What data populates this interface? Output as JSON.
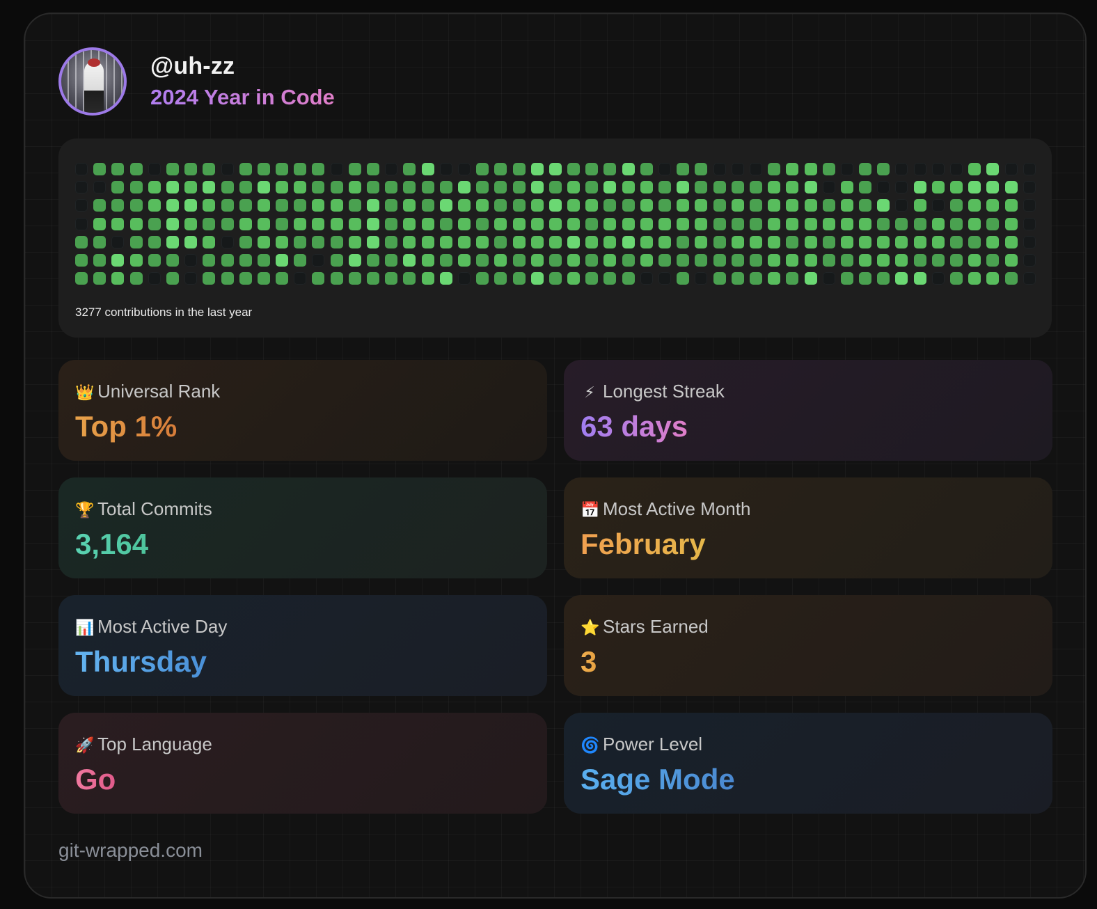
{
  "profile": {
    "username": "@uh-zz",
    "subtitle": "2024 Year in Code"
  },
  "contributions": {
    "caption": "3277 contributions in the last year",
    "weeks": [
      [
        0,
        0,
        0,
        0,
        2,
        2,
        2
      ],
      [
        2,
        0,
        2,
        3,
        2,
        2,
        2
      ],
      [
        2,
        2,
        2,
        3,
        0,
        4,
        3
      ],
      [
        2,
        2,
        2,
        3,
        2,
        3,
        2
      ],
      [
        0,
        3,
        3,
        2,
        2,
        2,
        0
      ],
      [
        2,
        4,
        4,
        4,
        4,
        2,
        2
      ],
      [
        2,
        3,
        4,
        3,
        4,
        0,
        0
      ],
      [
        2,
        4,
        3,
        2,
        3,
        2,
        2
      ],
      [
        0,
        2,
        2,
        2,
        0,
        2,
        2
      ],
      [
        2,
        2,
        2,
        3,
        2,
        2,
        2
      ],
      [
        2,
        4,
        3,
        3,
        3,
        2,
        2
      ],
      [
        2,
        3,
        2,
        2,
        3,
        4,
        2
      ],
      [
        2,
        3,
        2,
        3,
        2,
        2,
        0
      ],
      [
        2,
        2,
        3,
        3,
        2,
        0,
        2
      ],
      [
        0,
        2,
        3,
        3,
        2,
        2,
        2
      ],
      [
        2,
        3,
        2,
        3,
        3,
        4,
        2
      ],
      [
        2,
        2,
        4,
        4,
        4,
        2,
        2
      ],
      [
        0,
        2,
        2,
        2,
        2,
        2,
        2
      ],
      [
        2,
        2,
        3,
        3,
        3,
        4,
        2
      ],
      [
        4,
        2,
        2,
        3,
        3,
        3,
        3
      ],
      [
        0,
        2,
        4,
        2,
        3,
        2,
        4
      ],
      [
        0,
        4,
        3,
        3,
        3,
        3,
        0
      ],
      [
        2,
        2,
        3,
        2,
        3,
        2,
        2
      ],
      [
        2,
        2,
        2,
        3,
        2,
        3,
        2
      ],
      [
        2,
        2,
        2,
        3,
        3,
        2,
        2
      ],
      [
        4,
        4,
        3,
        3,
        3,
        3,
        4
      ],
      [
        4,
        2,
        4,
        3,
        3,
        2,
        2
      ],
      [
        2,
        3,
        3,
        3,
        4,
        3,
        3
      ],
      [
        2,
        2,
        3,
        2,
        3,
        2,
        2
      ],
      [
        2,
        4,
        2,
        3,
        3,
        3,
        2
      ],
      [
        4,
        3,
        2,
        3,
        4,
        2,
        2
      ],
      [
        2,
        3,
        3,
        3,
        3,
        3,
        0
      ],
      [
        0,
        2,
        2,
        3,
        3,
        2,
        0
      ],
      [
        2,
        4,
        3,
        3,
        2,
        2,
        2
      ],
      [
        2,
        2,
        3,
        3,
        3,
        2,
        0
      ],
      [
        0,
        2,
        2,
        2,
        2,
        2,
        2
      ],
      [
        0,
        2,
        3,
        2,
        3,
        2,
        2
      ],
      [
        0,
        2,
        2,
        2,
        3,
        2,
        2
      ],
      [
        2,
        3,
        3,
        3,
        3,
        3,
        3
      ],
      [
        3,
        3,
        3,
        3,
        2,
        3,
        2
      ],
      [
        3,
        4,
        3,
        3,
        3,
        3,
        4
      ],
      [
        2,
        0,
        2,
        3,
        2,
        2,
        0
      ],
      [
        0,
        3,
        3,
        3,
        3,
        2,
        2
      ],
      [
        2,
        2,
        2,
        3,
        3,
        3,
        2
      ],
      [
        2,
        0,
        4,
        2,
        3,
        3,
        2
      ],
      [
        0,
        0,
        0,
        2,
        3,
        3,
        4
      ],
      [
        0,
        4,
        3,
        2,
        3,
        2,
        4
      ],
      [
        0,
        3,
        0,
        3,
        3,
        2,
        0
      ],
      [
        0,
        3,
        2,
        2,
        2,
        2,
        2
      ],
      [
        3,
        4,
        3,
        3,
        2,
        3,
        3
      ],
      [
        4,
        4,
        3,
        2,
        3,
        2,
        3
      ],
      [
        0,
        4,
        3,
        3,
        3,
        3,
        2
      ],
      [
        0,
        0,
        0,
        0,
        0,
        0,
        0
      ]
    ]
  },
  "stats": {
    "rank": {
      "icon": "crown-icon",
      "glyph": "👑",
      "label": "Universal Rank",
      "value": "Top 1%"
    },
    "streak": {
      "icon": "lightning-icon",
      "glyph": "⚡",
      "label": "Longest Streak",
      "value": "63 days"
    },
    "commits": {
      "icon": "trophy-icon",
      "glyph": "🏆",
      "label": "Total Commits",
      "value": "3,164"
    },
    "month": {
      "icon": "calendar-icon",
      "glyph": "📅",
      "label": "Most Active Month",
      "value": "February"
    },
    "day": {
      "icon": "bar-chart-icon",
      "glyph": "📊",
      "label": "Most Active Day",
      "value": "Thursday"
    },
    "stars": {
      "icon": "star-icon",
      "glyph": "⭐",
      "label": "Stars Earned",
      "value": "3"
    },
    "language": {
      "icon": "rocket-icon",
      "glyph": "🚀",
      "label": "Top Language",
      "value": "Go"
    },
    "power": {
      "icon": "cyclone-icon",
      "glyph": "🌀",
      "label": "Power Level",
      "value": "Sage Mode"
    }
  },
  "footer": {
    "site": "git-wrapped.com"
  },
  "colors": {
    "level0": "#16191a",
    "level1": "#3e8a44",
    "level2": "#4aa150",
    "level3": "#58bd5d",
    "level4": "#6bd873",
    "avatar_ring": "#9d7ae8"
  }
}
